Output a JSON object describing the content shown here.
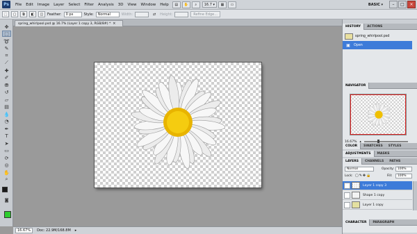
{
  "app": {
    "logo": "Ps"
  },
  "menubar": {
    "items": [
      "File",
      "Edit",
      "Image",
      "Layer",
      "Select",
      "Filter",
      "Analysis",
      "3D",
      "View",
      "Window",
      "Help"
    ],
    "zoom": "16.7",
    "workspace": "BASIC"
  },
  "options": {
    "feather_label": "Feather:",
    "feather_value": "0 px",
    "style_label": "Style:",
    "style_value": "Normal",
    "width_label": "Width:",
    "height_label": "Height:",
    "refine_edge": "Refine Edge..."
  },
  "document": {
    "tab_title": "spring_whirlpool.psd @ 16.7% (Layer 1 copy 3, RGB/8#) *",
    "close": "×"
  },
  "status": {
    "zoom": "16.67%",
    "doc_size": "Doc: 22.9M/168.8M"
  },
  "history": {
    "tabs": [
      "HISTORY",
      "ACTIONS"
    ],
    "items": [
      "spring_whirlpool.psd",
      "Open"
    ]
  },
  "navigator": {
    "tabs": [
      "NAVIGATOR"
    ],
    "zoom": "16.67%"
  },
  "color": {
    "tabs": [
      "COLOR",
      "SWATCHES",
      "STYLES"
    ]
  },
  "adjustments": {
    "tabs": [
      "ADJUSTMENTS",
      "MASKS"
    ]
  },
  "layers": {
    "tabs": [
      "LAYERS",
      "CHANNELS",
      "PATHS"
    ],
    "blend_mode": "Normal",
    "opacity_label": "Opacity:",
    "opacity_value": "100%",
    "lock_label": "Lock:",
    "fill_label": "Fill:",
    "fill_value": "100%",
    "items": [
      "Layer 1 copy 3",
      "Shape 1 copy",
      "Layer 1 copy"
    ]
  },
  "character": {
    "tabs": [
      "CHARACTER",
      "PARAGRAPH"
    ]
  },
  "colors": {
    "foreground": "#1a1a1a",
    "background": "#2ecc2e",
    "accent": "#3d7bd9",
    "flower_center": "#f2c200"
  }
}
